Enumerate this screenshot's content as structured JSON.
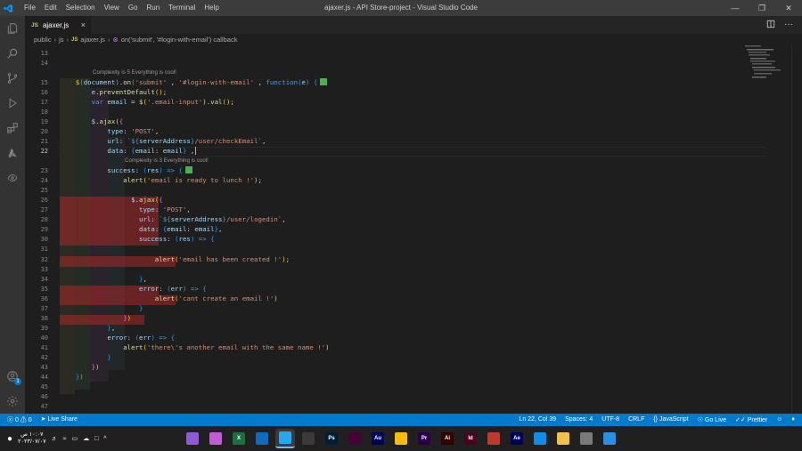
{
  "titlebar": {
    "menu": [
      "File",
      "Edit",
      "Selection",
      "View",
      "Go",
      "Run",
      "Terminal",
      "Help"
    ],
    "title": "ajaxer.js - API Store-project - Visual Studio Code"
  },
  "tab": {
    "icon_text": "JS",
    "label": "ajaxer.js"
  },
  "breadcrumb": {
    "public": "public",
    "js": "js",
    "file_icon": "JS",
    "file": "ajaxer.js",
    "symbol": "on('submit', '#login-with-email') callback"
  },
  "editor": {
    "lines": [
      {
        "n": "13",
        "code": ""
      },
      {
        "n": "14",
        "code": ""
      },
      {
        "n": "15",
        "code": "    $(document).on('submit' , '#login-with-email' , function(e) {"
      },
      {
        "n": "16",
        "code": "        e.preventDefault();"
      },
      {
        "n": "17",
        "code": "        var email = $('.email-input').val();"
      },
      {
        "n": "18",
        "code": ""
      },
      {
        "n": "19",
        "code": "        $.ajax({"
      },
      {
        "n": "20",
        "code": "            type: 'POST',"
      },
      {
        "n": "21",
        "code": "            url: `${serverAddress}/user/checkEmail`,"
      },
      {
        "n": "22",
        "code": "            data: {email: email} ,"
      },
      {
        "n": "23",
        "code": "            success: (res) => {"
      },
      {
        "n": "24",
        "code": "                alert('email is ready to lunch !');"
      },
      {
        "n": "25",
        "code": ""
      },
      {
        "n": "26",
        "code": "                $.ajax({"
      },
      {
        "n": "27",
        "code": "                    type: 'POST',"
      },
      {
        "n": "28",
        "code": "                    url: `${serverAddress}/user/logedin`,"
      },
      {
        "n": "29",
        "code": "                    data: {email: email},"
      },
      {
        "n": "30",
        "code": "                    success: (res) => {"
      },
      {
        "n": "31",
        "code": ""
      },
      {
        "n": "32",
        "code": "                        alert('email has been created !');"
      },
      {
        "n": "33",
        "code": ""
      },
      {
        "n": "34",
        "code": "                    },"
      },
      {
        "n": "35",
        "code": "                    error: (err) => {"
      },
      {
        "n": "36",
        "code": "                        alert('cant create an email !')"
      },
      {
        "n": "37",
        "code": "                    }"
      },
      {
        "n": "38",
        "code": "                })"
      },
      {
        "n": "39",
        "code": "            },"
      },
      {
        "n": "40",
        "code": "            error: (err) => {"
      },
      {
        "n": "41",
        "code": "                alert('there\\'s another email with the same name !')"
      },
      {
        "n": "42",
        "code": "            }"
      },
      {
        "n": "43",
        "code": "        })"
      },
      {
        "n": "44",
        "code": "    })"
      },
      {
        "n": "45",
        "code": ""
      },
      {
        "n": "46",
        "code": ""
      },
      {
        "n": "47",
        "code": ""
      }
    ],
    "lens_1": "Complexity is 5 Everything is cool!",
    "lens_2": "Complexity is 3 Everything is cool!"
  },
  "statusbar": {
    "errors": "0",
    "warnings": "0",
    "live_share": "Live Share",
    "position": "Ln 22, Col 39",
    "spaces": "Spaces: 4",
    "encoding": "UTF-8",
    "eol": "CRLF",
    "language": "JavaScript",
    "go_live": "Go Live",
    "prettier": "Prettier"
  },
  "taskbar": {
    "time": "١٠:٠٧ ص",
    "date": "٢٠٢٣/٠٧/٠٧",
    "apps": [
      {
        "name": "app-1",
        "label": "",
        "color": "#8e5bd6"
      },
      {
        "name": "app-2",
        "label": "",
        "color": "#c25bd6"
      },
      {
        "name": "excel",
        "label": "X",
        "color": "#1d6f42"
      },
      {
        "name": "mail",
        "label": "",
        "color": "#0f6cbd"
      },
      {
        "name": "vscode",
        "label": "",
        "color": "#23a9f2"
      },
      {
        "name": "sublime",
        "label": "",
        "color": "#3a3a3a"
      },
      {
        "name": "photoshop",
        "label": "Ps",
        "color": "#001e36"
      },
      {
        "name": "dreamweaver",
        "label": "",
        "color": "#470137"
      },
      {
        "name": "audition",
        "label": "Au",
        "color": "#00005b"
      },
      {
        "name": "chrome",
        "label": "",
        "color": "#fbbc05"
      },
      {
        "name": "premiere",
        "label": "Pr",
        "color": "#2a0046"
      },
      {
        "name": "illustrator",
        "label": "Ai",
        "color": "#330000"
      },
      {
        "name": "indesign",
        "label": "Id",
        "color": "#49021f"
      },
      {
        "name": "app-office",
        "label": "",
        "color": "#c0392b"
      },
      {
        "name": "after-effects",
        "label": "Ae",
        "color": "#00005b"
      },
      {
        "name": "edge",
        "label": "",
        "color": "#0c8ee9"
      },
      {
        "name": "file-explorer",
        "label": "",
        "color": "#f4c046"
      },
      {
        "name": "app-gray",
        "label": "",
        "color": "#7a7a7a"
      },
      {
        "name": "start",
        "label": "",
        "color": "#2a8fe8"
      }
    ]
  }
}
